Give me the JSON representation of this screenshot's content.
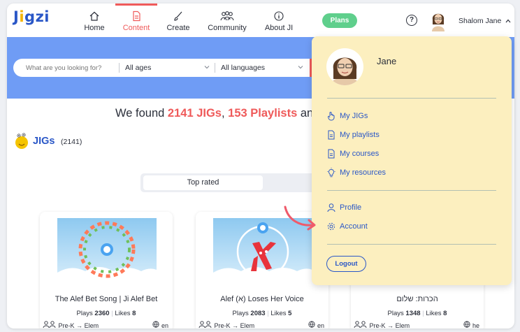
{
  "brand": {
    "logo_text": "Jigzi",
    "accent": "#ef5a5a",
    "primary": "#2a57c7",
    "hero_color": "#6f9cf5",
    "dropdown_bg": "#fcefbf"
  },
  "nav": {
    "items": [
      {
        "label": "Home",
        "icon": "home-icon"
      },
      {
        "label": "Content",
        "icon": "document-icon",
        "active": true
      },
      {
        "label": "Create",
        "icon": "brush-icon"
      },
      {
        "label": "Community",
        "icon": "people-icon"
      },
      {
        "label": "About JI",
        "icon": "info-icon"
      }
    ],
    "plans_label": "Plans",
    "help_label": "?",
    "username": "Shalom Jane"
  },
  "search": {
    "placeholder": "What are you looking for?",
    "age_value": "All ages",
    "language_value": "All languages"
  },
  "results": {
    "prefix": "We found",
    "jigs_count": "2141 JIGs",
    "comma": ",",
    "playlists_count": "153 Playlists",
    "suffix": "an"
  },
  "jigs_section": {
    "title": "JIGs",
    "count": "(2141)"
  },
  "sort": {
    "active_tab": "Top rated"
  },
  "cards": [
    {
      "title": "The Alef Bet Song | Ji Alef Bet",
      "plays_label": "Plays",
      "plays": "2360",
      "likes_label": "Likes",
      "likes": "8",
      "age_from": "Pre-K",
      "age_to": "Elem",
      "lang": "en"
    },
    {
      "title": "Alef (א) Loses Her Voice",
      "plays_label": "Plays",
      "plays": "2083",
      "likes_label": "Likes",
      "likes": "5",
      "age_from": "Pre-K",
      "age_to": "Elem",
      "lang": "en"
    },
    {
      "title": "הכרות: שלום",
      "plays_label": "Plays",
      "plays": "1348",
      "likes_label": "Likes",
      "likes": "8",
      "age_from": "Pre-K",
      "age_to": "Elem",
      "lang": "he"
    }
  ],
  "dropdown": {
    "name": "Jane",
    "items": [
      {
        "label": "My JIGs",
        "icon": "hand-icon"
      },
      {
        "label": "My playlists",
        "icon": "document-icon"
      },
      {
        "label": "My courses",
        "icon": "document-icon"
      },
      {
        "label": "My resources",
        "icon": "lightbulb-icon"
      }
    ],
    "profile_label": "Profile",
    "account_label": "Account",
    "logout_label": "Logout"
  }
}
